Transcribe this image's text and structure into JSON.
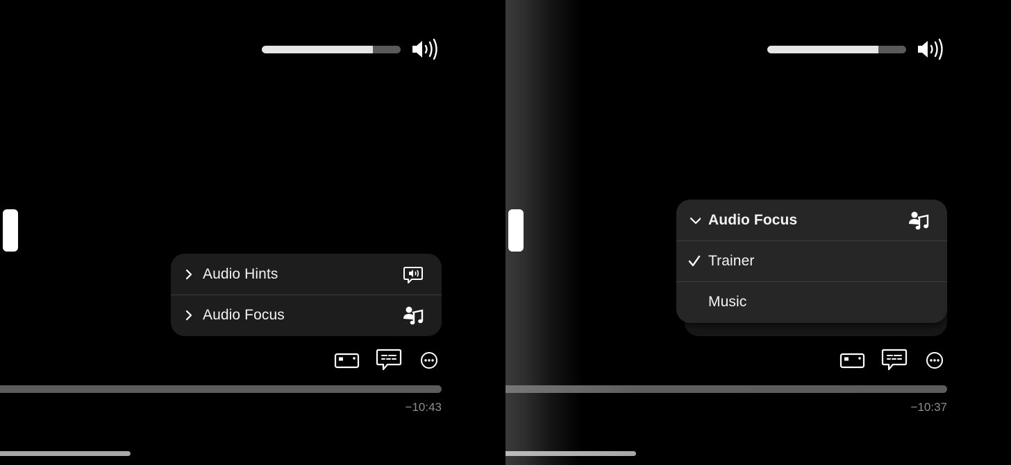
{
  "left_panel": {
    "volume": {
      "level_percent": 80,
      "icon": "speaker-wave-icon"
    },
    "menu": {
      "items": [
        {
          "label": "Audio Hints",
          "chevron": "chevron-right-icon",
          "icon": "speech-bubble-speaker-icon"
        },
        {
          "label": "Audio Focus",
          "chevron": "chevron-right-icon",
          "icon": "person-music-note-icon"
        }
      ]
    },
    "controls": [
      {
        "name": "picture-in-picture",
        "icon": "pip-icon"
      },
      {
        "name": "subtitles",
        "icon": "captions-bubble-icon"
      },
      {
        "name": "more",
        "icon": "ellipsis-circle-icon"
      }
    ],
    "playback": {
      "time_remaining": "−10:43"
    }
  },
  "right_panel": {
    "volume": {
      "level_percent": 80,
      "icon": "speaker-wave-icon"
    },
    "menu": {
      "header": {
        "label": "Audio Focus",
        "chevron": "chevron-down-icon",
        "icon": "person-music-note-icon"
      },
      "options": [
        {
          "label": "Trainer",
          "selected": true
        },
        {
          "label": "Music",
          "selected": false
        }
      ]
    },
    "controls": [
      {
        "name": "picture-in-picture",
        "icon": "pip-icon"
      },
      {
        "name": "subtitles",
        "icon": "captions-bubble-icon"
      },
      {
        "name": "more",
        "icon": "ellipsis-circle-icon"
      }
    ],
    "playback": {
      "time_remaining": "−10:37"
    }
  }
}
